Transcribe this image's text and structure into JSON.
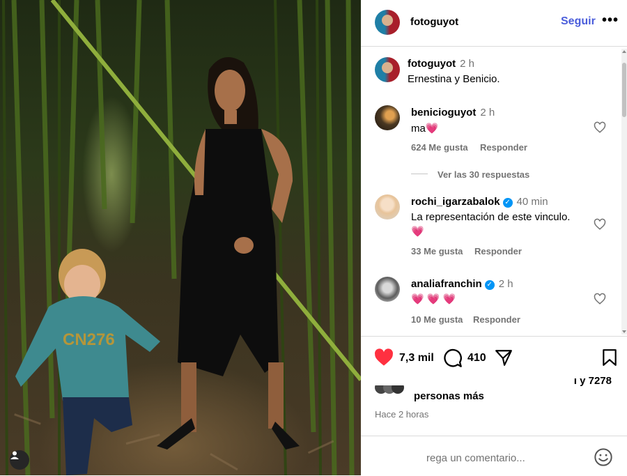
{
  "post": {
    "author": "fotoguyot",
    "follow_label": "Seguir",
    "more_icon": "more-dots-icon",
    "caption_author": "fotoguyot",
    "caption_time": "2 h",
    "caption_text": "Ernestina y Benicio.",
    "photo_badge_icon": "user-tag-icon"
  },
  "comments": [
    {
      "user": "benicioguyot",
      "time": "2 h",
      "text": "ma",
      "emoji": "💗",
      "likes": "624 Me gusta",
      "reply": "Responder",
      "verified": false
    },
    {
      "user": "rochi_igarzabalok",
      "time": "40 min",
      "text": "La representación de este vinculo.",
      "emoji": "💗",
      "likes": "33 Me gusta",
      "reply": "Responder",
      "verified": true
    },
    {
      "user": "analiafranchin",
      "time": "2 h",
      "text": "",
      "emoji": "💗 💗 💗",
      "likes": "10 Me gusta",
      "reply": "Responder",
      "verified": true
    }
  ],
  "replies_link": "Ver las 30 respuestas",
  "actions": {
    "likes_count": "7,3 mil",
    "comments_count": "410"
  },
  "liked_by": {
    "line1": "ı y 7278",
    "line2": "personas más"
  },
  "timestamp": "Hace 2 horas",
  "comment_box": {
    "placeholder": "rega un comentario..."
  },
  "colors": {
    "like_red": "#ff3040",
    "follow_blue": "#4a5ddb",
    "verified_blue": "#0095f6"
  }
}
